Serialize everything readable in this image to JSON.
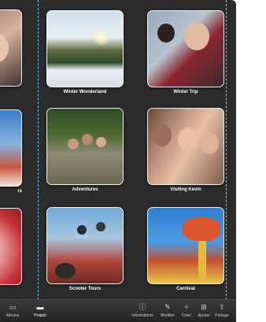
{
  "albums": [
    {
      "title": "Winter Wonderland"
    },
    {
      "title": "Winter Trip"
    },
    {
      "title": "Adventures"
    },
    {
      "title": "Visiting Kevin"
    },
    {
      "title": "Scooter Tours"
    },
    {
      "title": "Carnival"
    }
  ],
  "left_column": [
    {
      "title": ""
    },
    {
      "title": "rs"
    },
    {
      "title": ""
    }
  ],
  "toolbar": {
    "albums_label": "Albums",
    "projects_label": "Projets",
    "info_label": "Informations",
    "modify_label": "Modifier",
    "create_label": "Créer",
    "add_label": "Ajouter",
    "share_label": "Partage"
  },
  "colors": {
    "background": "#2b2b2c",
    "guide": "#6ec6f2",
    "text": "#ffffff"
  }
}
